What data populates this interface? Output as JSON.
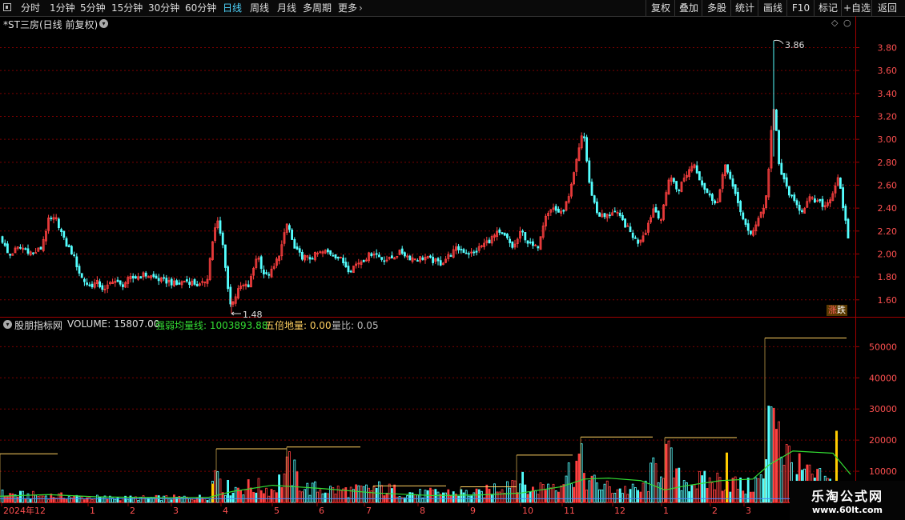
{
  "toolbar": {
    "left": [
      "分时",
      "1分钟",
      "5分钟",
      "15分钟",
      "30分钟",
      "60分钟",
      "日线",
      "周线",
      "月线",
      "多周期",
      "更多"
    ],
    "active": "日线",
    "right": [
      "复权",
      "叠加",
      "多股",
      "统计",
      "画线",
      "F10",
      "+自选",
      "返回",
      "标记"
    ]
  },
  "price_panel": {
    "title": "*ST三房(日线 前复权)",
    "high_label": "3.86",
    "low_label": "1.48",
    "y_ticks": [
      "3.80",
      "3.60",
      "3.40",
      "3.20",
      "3.00",
      "2.80",
      "2.60",
      "2.40",
      "2.20",
      "2.00",
      "1.80",
      "1.60"
    ],
    "badge_a": "涨",
    "badge_b": "跌"
  },
  "volume_panel": {
    "indicator": "股朋指标网",
    "volume_label": "VOLUME: 15807.00",
    "strong_weak_label": "强弱均量线: 1003893.88",
    "five_times_label": "五倍地量: 0.00",
    "ratio_label": "量比: 0.05",
    "y_ticks": [
      "50000",
      "40000",
      "30000",
      "20000",
      "10000"
    ]
  },
  "x_axis": {
    "labels": [
      "2024年12",
      "1",
      "2",
      "3",
      "4",
      "5",
      "6",
      "7",
      "8",
      "9",
      "10",
      "11",
      "12",
      "1",
      "2",
      "3"
    ]
  },
  "watermark": {
    "title": "乐淘公式网",
    "url": "www.60lt.com"
  },
  "colors": {
    "up": "#ff4040",
    "down": "#54ffff",
    "grid": "#7a0000",
    "ma": "#33dd33",
    "ma2": "#4488ff",
    "highlight_line": "#ffd060",
    "highlight_bar": "#ffcc00",
    "toolbar_active": "#4fd6ff"
  },
  "chart_data": {
    "type": "candlestick",
    "title": "*ST三房(日线 前复权)",
    "price_range": [
      1.48,
      3.86
    ],
    "price_ylim": [
      1.48,
      3.95
    ],
    "volume_ylim": [
      0,
      56000
    ],
    "labeled_high": 3.86,
    "labeled_low": 1.48,
    "price_close_anchors": [
      [
        0,
        2.15
      ],
      [
        10,
        1.98
      ],
      [
        20,
        2.05
      ],
      [
        30,
        2.05
      ],
      [
        40,
        2.0
      ],
      [
        50,
        2.05
      ],
      [
        60,
        2.3
      ],
      [
        70,
        2.3
      ],
      [
        80,
        2.1
      ],
      [
        90,
        2.0
      ],
      [
        100,
        1.8
      ],
      [
        110,
        1.72
      ],
      [
        120,
        1.75
      ],
      [
        130,
        1.68
      ],
      [
        140,
        1.78
      ],
      [
        150,
        1.72
      ],
      [
        160,
        1.78
      ],
      [
        170,
        1.8
      ],
      [
        180,
        1.82
      ],
      [
        190,
        1.8
      ],
      [
        200,
        1.77
      ],
      [
        210,
        1.76
      ],
      [
        220,
        1.73
      ],
      [
        230,
        1.77
      ],
      [
        240,
        1.75
      ],
      [
        250,
        1.72
      ],
      [
        258,
        1.8
      ],
      [
        264,
        2.1
      ],
      [
        270,
        2.3
      ],
      [
        278,
        2.05
      ],
      [
        286,
        1.55
      ],
      [
        290,
        1.6
      ],
      [
        300,
        1.72
      ],
      [
        310,
        1.72
      ],
      [
        320,
        2.0
      ],
      [
        330,
        1.8
      ],
      [
        340,
        1.86
      ],
      [
        350,
        2.05
      ],
      [
        358,
        2.28
      ],
      [
        366,
        2.05
      ],
      [
        375,
        1.98
      ],
      [
        385,
        1.96
      ],
      [
        395,
        2.0
      ],
      [
        405,
        2.02
      ],
      [
        415,
        2.0
      ],
      [
        425,
        1.95
      ],
      [
        435,
        1.86
      ],
      [
        445,
        1.92
      ],
      [
        455,
        1.96
      ],
      [
        465,
        2.02
      ],
      [
        475,
        1.96
      ],
      [
        485,
        1.95
      ],
      [
        500,
        2.02
      ],
      [
        510,
        1.97
      ],
      [
        520,
        1.96
      ],
      [
        530,
        1.97
      ],
      [
        540,
        1.94
      ],
      [
        550,
        1.92
      ],
      [
        560,
        1.99
      ],
      [
        570,
        2.05
      ],
      [
        580,
        2.02
      ],
      [
        590,
        2.0
      ],
      [
        600,
        2.07
      ],
      [
        610,
        2.12
      ],
      [
        620,
        2.18
      ],
      [
        630,
        2.15
      ],
      [
        640,
        2.05
      ],
      [
        650,
        2.2
      ],
      [
        660,
        2.08
      ],
      [
        670,
        2.05
      ],
      [
        680,
        2.35
      ],
      [
        690,
        2.4
      ],
      [
        700,
        2.35
      ],
      [
        710,
        2.5
      ],
      [
        720,
        2.85
      ],
      [
        727,
        3.1
      ],
      [
        735,
        2.6
      ],
      [
        745,
        2.35
      ],
      [
        755,
        2.32
      ],
      [
        765,
        2.38
      ],
      [
        775,
        2.3
      ],
      [
        785,
        2.2
      ],
      [
        795,
        2.1
      ],
      [
        805,
        2.2
      ],
      [
        815,
        2.4
      ],
      [
        825,
        2.3
      ],
      [
        835,
        2.7
      ],
      [
        845,
        2.55
      ],
      [
        855,
        2.68
      ],
      [
        865,
        2.8
      ],
      [
        875,
        2.62
      ],
      [
        885,
        2.5
      ],
      [
        895,
        2.45
      ],
      [
        905,
        2.8
      ],
      [
        915,
        2.55
      ],
      [
        925,
        2.35
      ],
      [
        935,
        2.15
      ],
      [
        945,
        2.3
      ],
      [
        955,
        2.45
      ],
      [
        960,
        2.85
      ],
      [
        964,
        3.3
      ],
      [
        968,
        3.1
      ],
      [
        972,
        2.75
      ],
      [
        980,
        2.6
      ],
      [
        990,
        2.45
      ],
      [
        1000,
        2.38
      ],
      [
        1010,
        2.48
      ],
      [
        1020,
        2.45
      ],
      [
        1030,
        2.42
      ],
      [
        1040,
        2.55
      ],
      [
        1046,
        2.7
      ],
      [
        1050,
        2.45
      ],
      [
        1054,
        2.3
      ],
      [
        1058,
        2.15
      ],
      [
        1062,
        2.05
      ]
    ],
    "volume_anchors": [
      [
        0,
        3000
      ],
      [
        30,
        2500
      ],
      [
        60,
        2400
      ],
      [
        100,
        1800
      ],
      [
        150,
        1500
      ],
      [
        200,
        1600
      ],
      [
        260,
        1800
      ],
      [
        270,
        14000
      ],
      [
        280,
        5000
      ],
      [
        320,
        5500
      ],
      [
        340,
        4500
      ],
      [
        360,
        12000
      ],
      [
        380,
        5000
      ],
      [
        440,
        4000
      ],
      [
        470,
        5000
      ],
      [
        520,
        3000
      ],
      [
        560,
        3500
      ],
      [
        600,
        3000
      ],
      [
        645,
        9000
      ],
      [
        660,
        4000
      ],
      [
        700,
        8000
      ],
      [
        715,
        12000
      ],
      [
        722,
        15000
      ],
      [
        735,
        7000
      ],
      [
        760,
        5000
      ],
      [
        800,
        4000
      ],
      [
        830,
        17000
      ],
      [
        845,
        8000
      ],
      [
        880,
        7000
      ],
      [
        905,
        8000
      ],
      [
        930,
        5000
      ],
      [
        955,
        9000
      ],
      [
        962,
        40000
      ],
      [
        968,
        42000
      ],
      [
        975,
        20000
      ],
      [
        990,
        12000
      ],
      [
        1010,
        9000
      ],
      [
        1040,
        6000
      ],
      [
        1062,
        5000
      ]
    ],
    "strong_weak_line": [
      [
        0,
        2000
      ],
      [
        60,
        2500
      ],
      [
        120,
        1800
      ],
      [
        200,
        1500
      ],
      [
        260,
        1600
      ],
      [
        290,
        3500
      ],
      [
        340,
        5500
      ],
      [
        400,
        4500
      ],
      [
        470,
        3000
      ],
      [
        540,
        2200
      ],
      [
        600,
        2400
      ],
      [
        650,
        3000
      ],
      [
        700,
        5000
      ],
      [
        730,
        7500
      ],
      [
        760,
        7800
      ],
      [
        800,
        7000
      ],
      [
        830,
        4000
      ],
      [
        860,
        5500
      ],
      [
        900,
        7000
      ],
      [
        940,
        7500
      ],
      [
        960,
        12000
      ],
      [
        990,
        16500
      ],
      [
        1040,
        15800
      ],
      [
        1062,
        9000
      ]
    ],
    "five_times_ground_line": [
      [
        0,
        1200
      ],
      [
        1062,
        1200
      ]
    ],
    "volume_step_segments": [
      [
        0,
        72,
        15600
      ],
      [
        270,
        358,
        17200
      ],
      [
        358,
        450,
        17800
      ],
      [
        466,
        557,
        5300
      ],
      [
        575,
        645,
        5000
      ],
      [
        645,
        715,
        15200
      ],
      [
        725,
        815,
        21000
      ],
      [
        830,
        920,
        20800
      ],
      [
        955,
        1057,
        52800
      ]
    ],
    "highlight_bars": [
      [
        264,
        6000
      ],
      [
        906,
        16000
      ],
      [
        1043,
        23000
      ]
    ]
  }
}
